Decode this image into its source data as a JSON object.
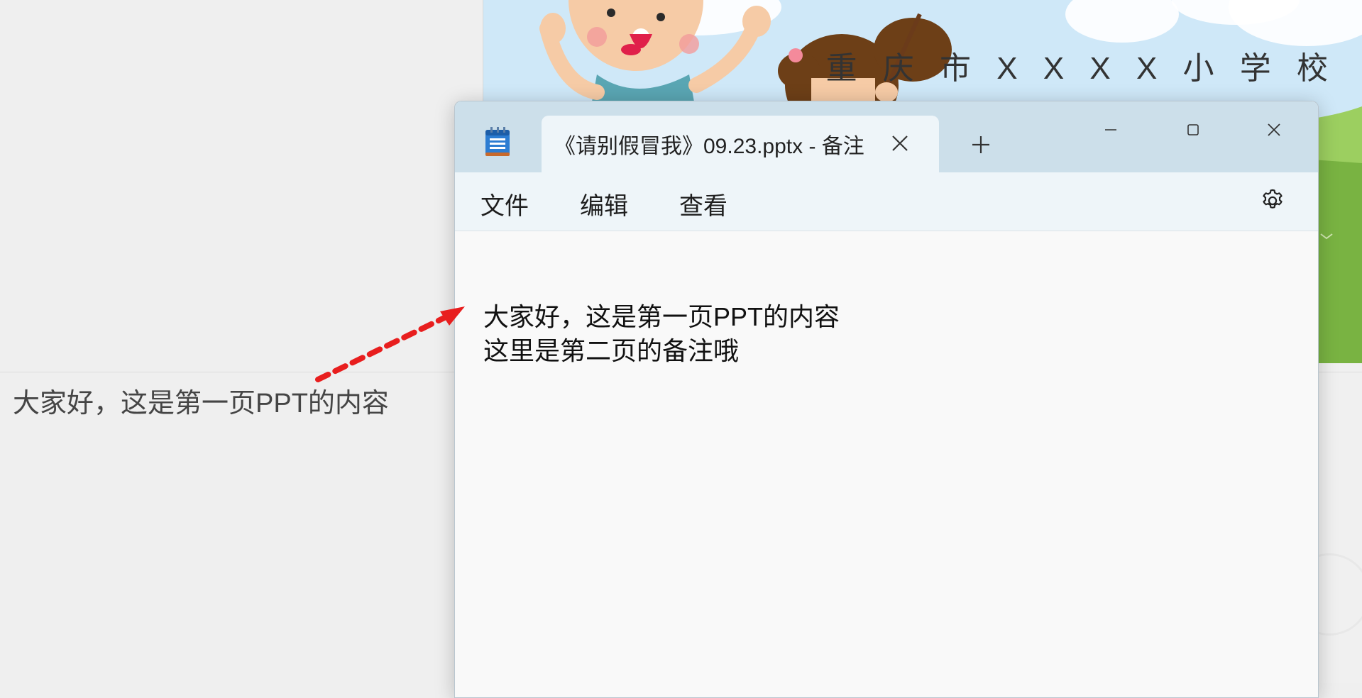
{
  "powerpoint": {
    "notes_text": "大家好，这是第一页PPT的内容",
    "slide_title": "重 庆 市 X X X X 小 学 校"
  },
  "notepad": {
    "app_icon": "notepad-icon",
    "tab_title": "《请别假冒我》09.23.pptx - 备注",
    "menu": {
      "file": "文件",
      "edit": "编辑",
      "view": "查看"
    },
    "content_lines": [
      "大家好，这是第一页PPT的内容",
      "这里是第二页的备注哦"
    ]
  },
  "colors": {
    "arrow": "#e81e1e",
    "titlebar": "#ccdfea",
    "menubar": "#eef5f9",
    "editor_bg": "#f9f9f9"
  }
}
